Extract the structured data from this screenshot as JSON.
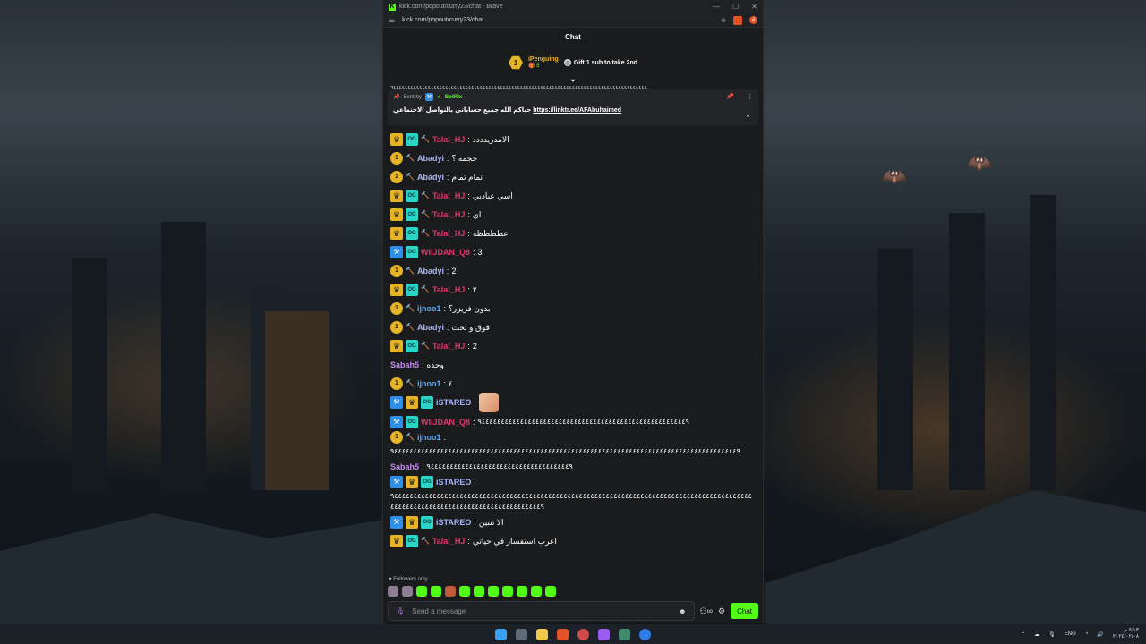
{
  "window": {
    "title": "kick.com/popout/curry23/chat - Brave",
    "url": "kick.com/popout/curry23/chat",
    "notification_count": "4"
  },
  "chat": {
    "header": "Chat",
    "leaderboard": {
      "rank": "1",
      "name": "iPenguing",
      "count": "5",
      "gift_text": "Gift 1 sub to take 2nd"
    },
    "pinned": {
      "sent_by_label": "Sent by",
      "bot_name": "BotRix",
      "text": "حياكم الله جميع حساباتي بالتواصل الاجتماعي",
      "link": "https://linktr.ee/AFAbuhaimed"
    },
    "messages": [
      {
        "badges": [
          "crown",
          "og",
          "hammer"
        ],
        "user": "Talal_HJ",
        "color": "#e8336b",
        "text": "الامدريدددد"
      },
      {
        "badges": [
          "sub",
          "hammer"
        ],
        "user": "Abadyi",
        "color": "#aab7f5",
        "text": "خجمه ؟"
      },
      {
        "badges": [
          "sub",
          "hammer"
        ],
        "user": "Abadyi",
        "color": "#aab7f5",
        "text": "تمام تمام"
      },
      {
        "badges": [
          "crown",
          "og",
          "hammer"
        ],
        "user": "Talal_HJ",
        "color": "#e8336b",
        "text": "اسي عباديي"
      },
      {
        "badges": [
          "crown",
          "og",
          "hammer"
        ],
        "user": "Talal_HJ",
        "color": "#e8336b",
        "text": "اي"
      },
      {
        "badges": [
          "crown",
          "og",
          "hammer"
        ],
        "user": "Talal_HJ",
        "color": "#e8336b",
        "text": "عطططظه"
      },
      {
        "badges": [
          "mod",
          "og"
        ],
        "user": "WIIJDAN_Q8",
        "color": "#e8336b",
        "text": "3"
      },
      {
        "badges": [
          "sub",
          "hammer"
        ],
        "user": "Abadyi",
        "color": "#aab7f5",
        "text": "2"
      },
      {
        "badges": [
          "crown",
          "og",
          "hammer"
        ],
        "user": "Talal_HJ",
        "color": "#e8336b",
        "text": "٢"
      },
      {
        "badges": [
          "sub",
          "hammer"
        ],
        "user": "ijnoo1",
        "color": "#5ba8ef",
        "text": "بدون فريزر؟"
      },
      {
        "badges": [
          "sub",
          "hammer"
        ],
        "user": "Abadyi",
        "color": "#aab7f5",
        "text": "فوق و تحت"
      },
      {
        "badges": [
          "crown",
          "og",
          "hammer"
        ],
        "user": "Talal_HJ",
        "color": "#e8336b",
        "text": "2"
      },
      {
        "badges": [],
        "user": "Sabah5",
        "color": "#c48cf0",
        "text": "وحده"
      },
      {
        "badges": [
          "sub",
          "hammer"
        ],
        "user": "ijnoo1",
        "color": "#5ba8ef",
        "text": "٤"
      },
      {
        "badges": [
          "mod",
          "crown",
          "og"
        ],
        "user": "iSTAREO",
        "color": "#aab7f5",
        "text": "",
        "emote": true
      },
      {
        "badges": [
          "mod",
          "og"
        ],
        "user": "WIIJDAN_Q8",
        "color": "#e8336b",
        "text": "٩٤٤٤٤٤٤٤٤٤٤٤٤٤٤٤٤٤٤٤٤٤٤٤٤٤٤٤٤٤٤٤٤٤٤٤٤٤٤٤٤٤٤٤٤٤٤٤٤٤٤٤٤٤٩"
      },
      {
        "badges": [
          "sub",
          "hammer"
        ],
        "user": "ijnoo1",
        "color": "#5ba8ef",
        "text": "٩٤٤٤٤٤٤٤٤٤٤٤٤٤٤٤٤٤٤٤٤٤٤٤٤٤٤٤٤٤٤٤٤٤٤٤٤٤٤٤٤٤٤٤٤٤٤٤٤٤٤٤٤٤٤٤٤٤٤٤٤٤٤٤٤٤٤٤٤٤٤٤٤٤٤٤٤٤٤٤٤٤٤٤٤٤٤٤٤٤٩"
      },
      {
        "badges": [],
        "user": "Sabah5",
        "color": "#c48cf0",
        "text": "٩٤٤٤٤٤٤٤٤٤٤٤٤٤٤٤٤٤٤٤٤٤٤٤٤٤٤٤٤٤٤٤٤٤٤٤٤٩"
      },
      {
        "badges": [
          "mod",
          "crown",
          "og"
        ],
        "user": "iSTAREO",
        "color": "#aab7f5",
        "text": "٩٤٤٤٤٤٤٤٤٤٤٤٤٤٤٤٤٤٤٤٤٤٤٤٤٤٤٤٤٤٤٤٤٤٤٤٤٤٤٤٤٤٤٤٤٤٤٤٤٤٤٤٤٤٤٤٤٤٤٤٤٤٤٤٤٤٤٤٤٤٤٤٤٤٤٤٤٤٤٤٤٤٤٤٤٤٤٤٤٤٤٤٤٤٤٤٤٤٤٤٤٤٤٤٤٤٤٤٤٤٤٤٤٤٤٤٤٤٤٤٤٤٤٤٤٤٤٤٤٤٤٤٤٩"
      },
      {
        "badges": [
          "mod",
          "crown",
          "og"
        ],
        "user": "iSTAREO",
        "color": "#aab7f5",
        "text": "الا تنتين"
      },
      {
        "badges": [
          "crown",
          "og",
          "hammer"
        ],
        "user": "Talal_HJ",
        "color": "#e8336b",
        "text": "اعرب استفسار في حياتي"
      }
    ],
    "followers_only": "Followers only",
    "input_placeholder": "Send a message",
    "chat_button": "Chat"
  },
  "taskbar": {
    "lang": "ENG",
    "time": "٥:١٣ م",
    "date": "٢٠٢٤/٠٢/٠٨"
  },
  "colors": {
    "kick_green": "#53fc18",
    "gold": "#e5b327",
    "chat_bg": "#1a1b1d"
  }
}
